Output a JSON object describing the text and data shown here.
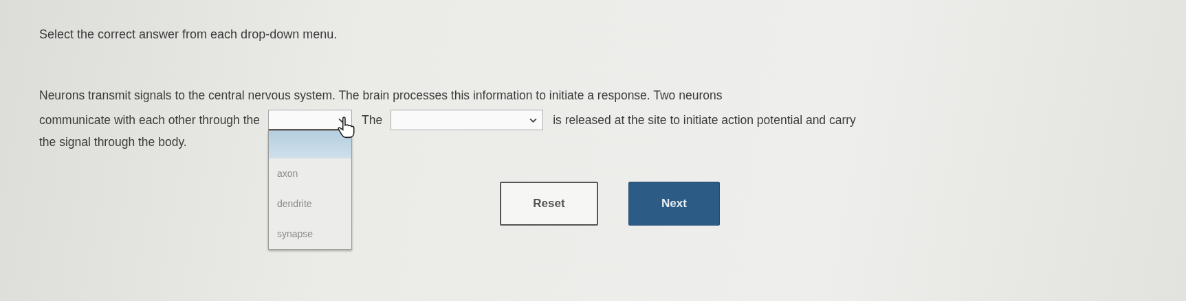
{
  "instruction": "Select the correct answer from each drop-down menu.",
  "paragraph": [
    {
      "segments": [
        {
          "kind": "text",
          "text": "Neurons transmit signals to the central nervous system. The brain processes this information to initiate a response. Two neurons"
        }
      ]
    },
    {
      "segments": [
        {
          "kind": "text",
          "text": "communicate with each other through the"
        },
        {
          "kind": "dropdown",
          "expanded": true,
          "options": [
            {
              "label": "axon",
              "selected": false
            },
            {
              "label": "dendrite",
              "selected": false
            },
            {
              "label": "synapse",
              "selected": false
            }
          ]
        },
        {
          "kind": "text",
          "text": "The"
        },
        {
          "kind": "dropdown",
          "expanded": false
        },
        {
          "kind": "text",
          "text": "is released at the site to initiate action potential and carry"
        }
      ]
    },
    {
      "segments": [
        {
          "kind": "text",
          "text": "the signal through the body."
        }
      ]
    }
  ],
  "buttons": [
    {
      "label": "Reset",
      "kind": "secondary"
    },
    {
      "label": "Next",
      "kind": "primary"
    }
  ]
}
